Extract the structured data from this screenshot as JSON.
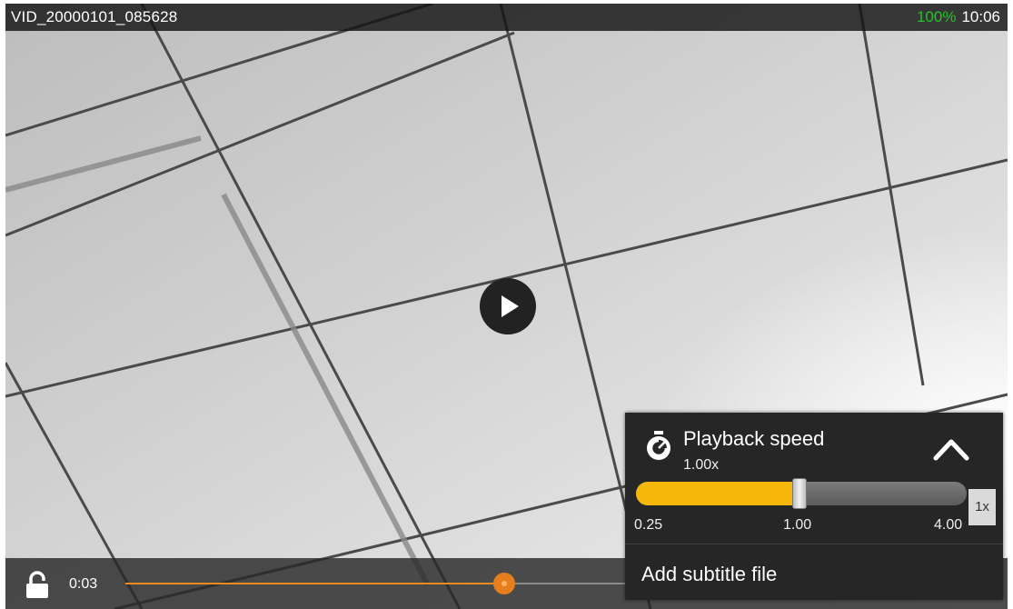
{
  "header": {
    "title": "VID_20000101_085628",
    "battery": "100%",
    "clock": "10:06",
    "battery_color": "#25c22a"
  },
  "player": {
    "play_icon": "play-icon",
    "state": "paused"
  },
  "controls": {
    "lock_icon": "lock-icon",
    "elapsed": "0:03",
    "progress": 0.76,
    "accent_color": "#f08c1c"
  },
  "menu": {
    "speed_icon": "speed-dial-icon",
    "title": "Playback speed",
    "value": "1.00x",
    "collapse_icon": "chevron-up-icon",
    "slider": {
      "min_label": "0.25",
      "mid_label": "1.00",
      "max_label": "4.00",
      "current": 1.0,
      "fill_color": "#f4b70a"
    },
    "reset_label": "1x",
    "add_subtitle_label": "Add subtitle file"
  }
}
